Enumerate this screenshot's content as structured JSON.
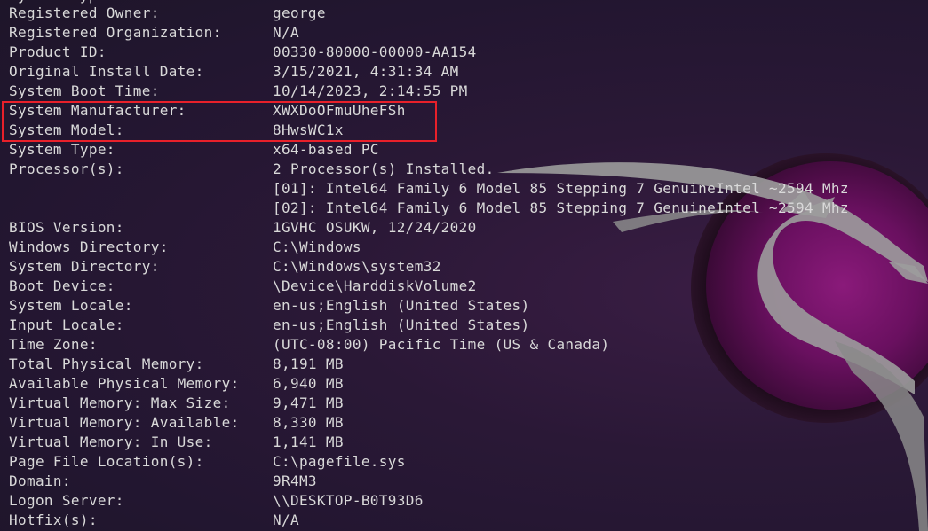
{
  "terminal": {
    "partial_top_line": "System Type ... Processor",
    "rows": [
      {
        "key": "Registered Owner:",
        "value": "george"
      },
      {
        "key": "Registered Organization:",
        "value": "N/A"
      },
      {
        "key": "Product ID:",
        "value": "00330-80000-00000-AA154"
      },
      {
        "key": "Original Install Date:",
        "value": "3/15/2021, 4:31:34 AM"
      },
      {
        "key": "System Boot Time:",
        "value": "10/14/2023, 2:14:55 PM"
      },
      {
        "key": "System Manufacturer:",
        "value": "XWXDoOFmuUheFSh"
      },
      {
        "key": "System Model:",
        "value": "8HwsWC1x"
      },
      {
        "key": "System Type:",
        "value": "x64-based PC"
      },
      {
        "key": "Processor(s):",
        "value": "2 Processor(s) Installed."
      },
      {
        "key": "",
        "value": "[01]: Intel64 Family 6 Model 85 Stepping 7 GenuineIntel ~2594 Mhz"
      },
      {
        "key": "",
        "value": "[02]: Intel64 Family 6 Model 85 Stepping 7 GenuineIntel ~2594 Mhz"
      },
      {
        "key": "BIOS Version:",
        "value": "1GVHC OSUKW, 12/24/2020"
      },
      {
        "key": "Windows Directory:",
        "value": "C:\\Windows"
      },
      {
        "key": "System Directory:",
        "value": "C:\\Windows\\system32"
      },
      {
        "key": "Boot Device:",
        "value": "\\Device\\HarddiskVolume2"
      },
      {
        "key": "System Locale:",
        "value": "en-us;English (United States)"
      },
      {
        "key": "Input Locale:",
        "value": "en-us;English (United States)"
      },
      {
        "key": "Time Zone:",
        "value": "(UTC-08:00) Pacific Time (US & Canada)"
      },
      {
        "key": "Total Physical Memory:",
        "value": "8,191 MB"
      },
      {
        "key": "Available Physical Memory:",
        "value": "6,940 MB"
      },
      {
        "key": "Virtual Memory: Max Size:",
        "value": "9,471 MB"
      },
      {
        "key": "Virtual Memory: Available:",
        "value": "8,330 MB"
      },
      {
        "key": "Virtual Memory: In Use:",
        "value": "1,141 MB"
      },
      {
        "key": "Page File Location(s):",
        "value": "C:\\pagefile.sys"
      },
      {
        "key": "Domain:",
        "value": "9R4M3"
      },
      {
        "key": "Logon Server:",
        "value": "\\\\DESKTOP-B0T93D6"
      },
      {
        "key": "Hotfix(s):",
        "value": "N/A"
      }
    ]
  },
  "colors": {
    "text": "#d9d9d9",
    "highlight": "#e8202a",
    "background": "#221630",
    "logo_ring": "#5a0f4f",
    "dragon": "#9a9a9a"
  },
  "icons": {
    "wallpaper": "kali-dragon-logo"
  }
}
